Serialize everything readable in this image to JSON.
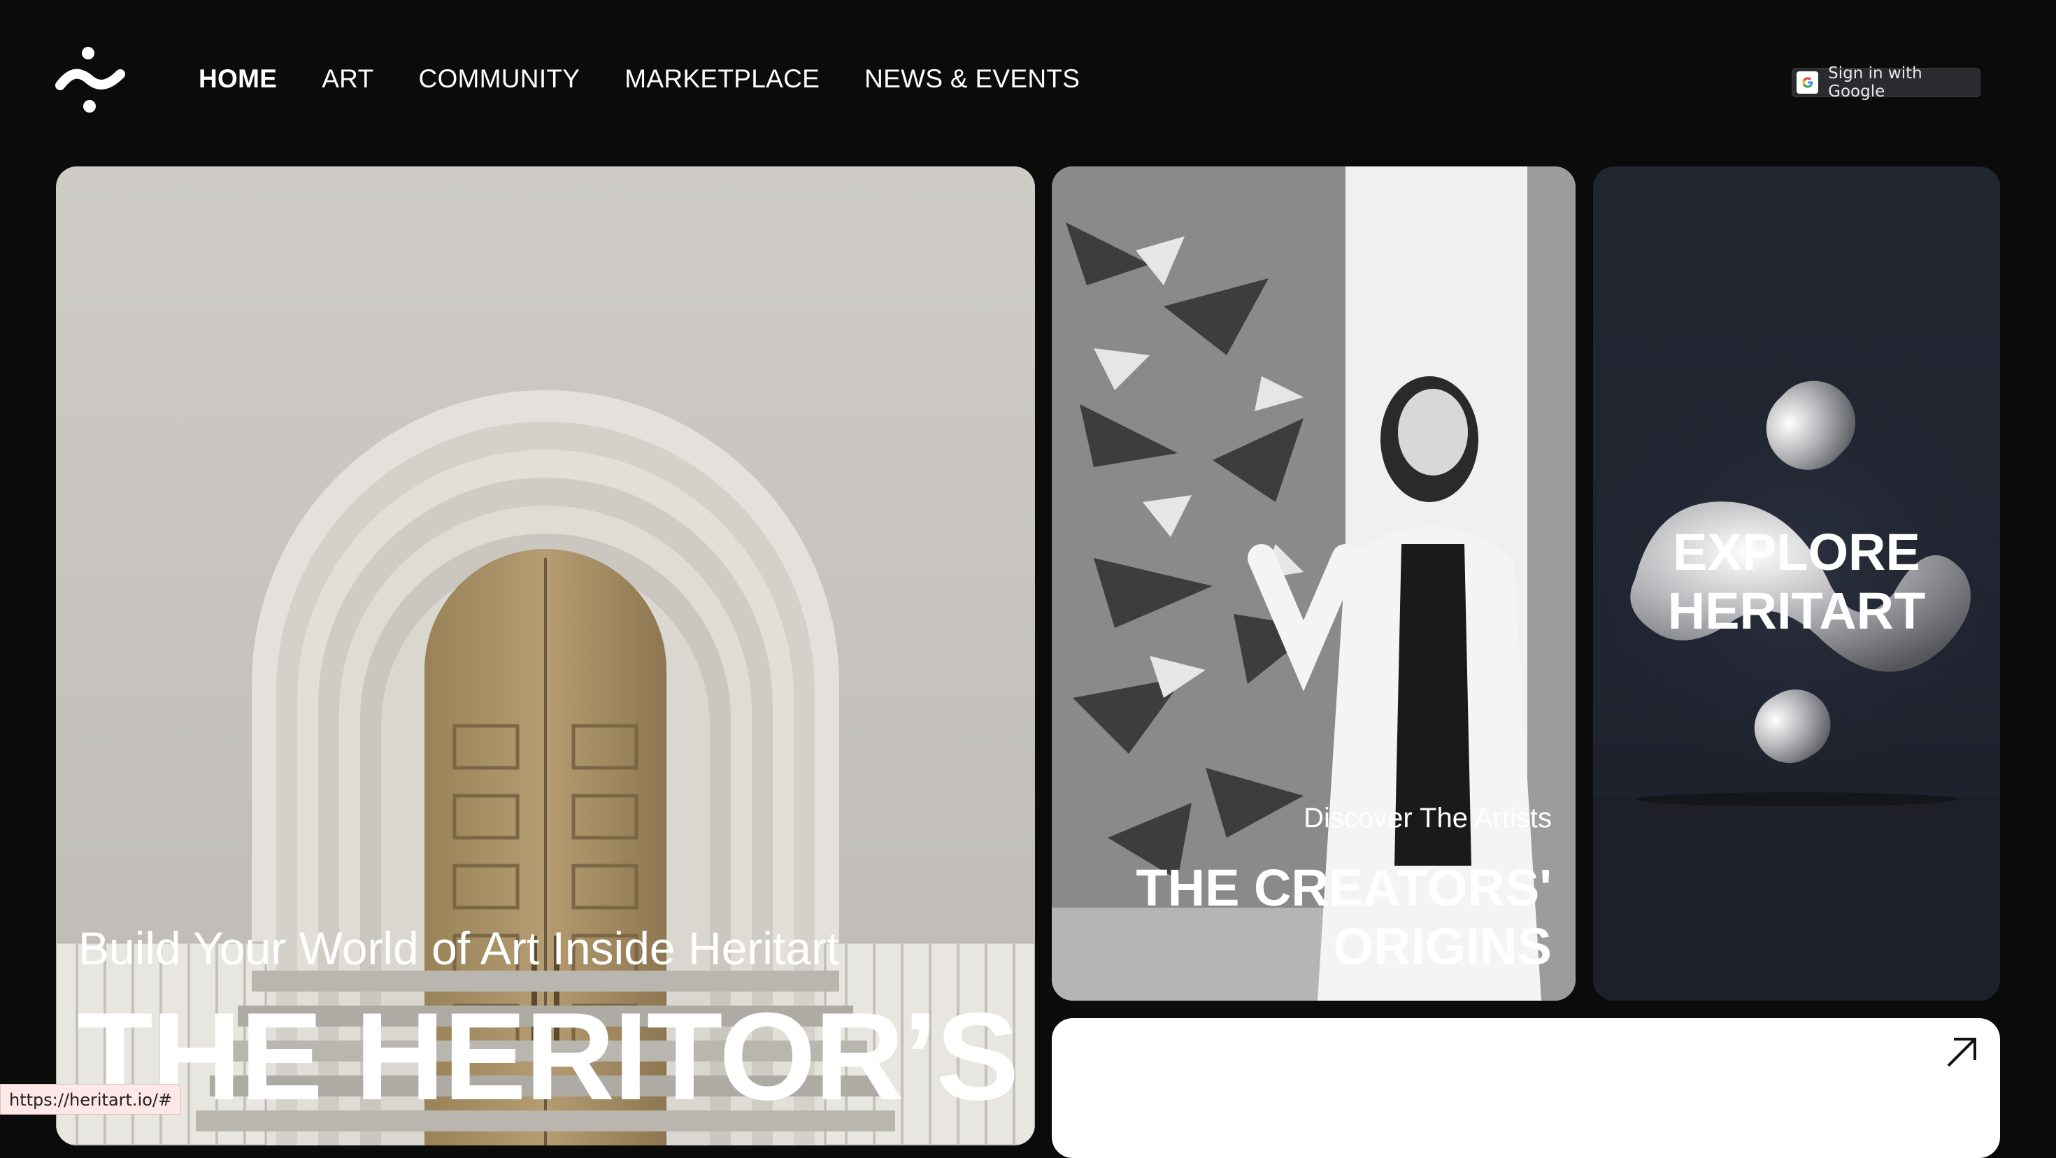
{
  "nav": {
    "items": [
      {
        "label": "HOME",
        "active": true
      },
      {
        "label": "ART",
        "active": false
      },
      {
        "label": "COMMUNITY",
        "active": false
      },
      {
        "label": "MARKETPLACE",
        "active": false
      },
      {
        "label": "NEWS & EVENTS",
        "active": false
      }
    ]
  },
  "auth": {
    "google_label": "Sign in with Google",
    "icon": "google-g-icon"
  },
  "hero": {
    "subtitle": "Build Your World of Art Inside Heritart",
    "title": "THE HERITOR’S"
  },
  "creators": {
    "subtitle": "Discover The Artists",
    "title_line1": "THE CREATORS'",
    "title_line2": "ORIGINS"
  },
  "explore": {
    "title_line1": "EXPLORE",
    "title_line2": "HERITART"
  },
  "white_card": {
    "icon": "arrow-up-right-icon"
  },
  "status_bar": {
    "url": "https://heritart.io/#"
  },
  "colors": {
    "background": "#0b0b0b",
    "explore_card": "#222631",
    "text": "#ffffff"
  }
}
